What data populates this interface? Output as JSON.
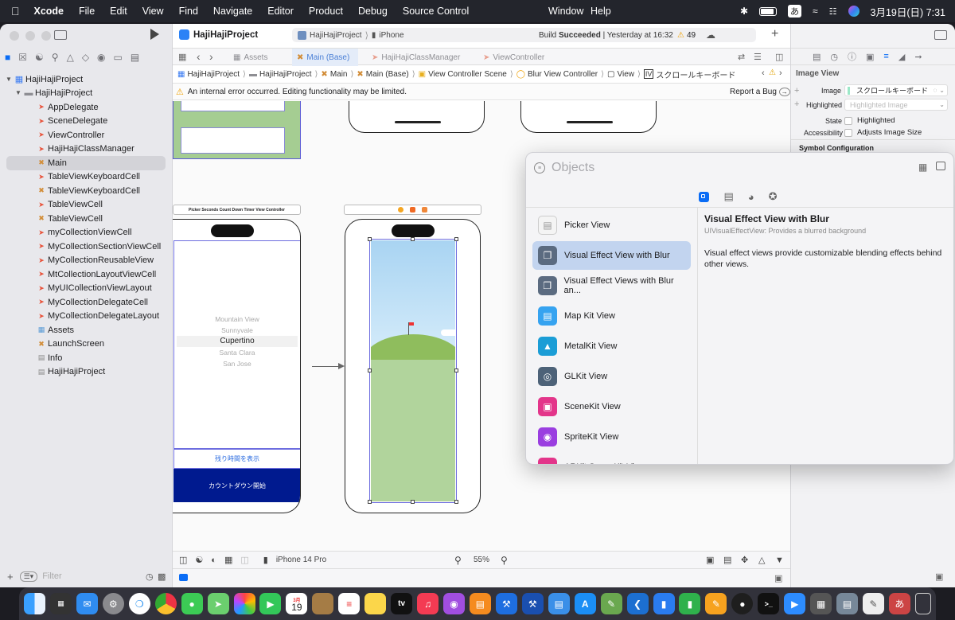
{
  "menubar": {
    "app": "Xcode",
    "items": [
      "File",
      "Edit",
      "View",
      "Find",
      "Navigate",
      "Editor",
      "Product",
      "Debug",
      "Source Control"
    ],
    "window": "Window",
    "help": "Help",
    "input_method": "あ",
    "clock": "3月19日(日)  7:31"
  },
  "toolbar": {
    "project": "HajiHajiProject",
    "scheme": "HajiHajiProject",
    "device": "iPhone",
    "status_prefix": "Build ",
    "status_bold": "Succeeded",
    "status_suffix": " | Yesterday at 16:32",
    "warnings": "49"
  },
  "tabs": [
    "Assets",
    "Main (Base)",
    "HajiHajiClassManager",
    "ViewController"
  ],
  "jumpbar": [
    "HajiHajiProject",
    "HajiHajiProject",
    "Main",
    "Main (Base)",
    "View Controller Scene",
    "Blur View Controller",
    "View",
    "スクロールキーボード"
  ],
  "warning_bar": {
    "message": "An internal error occurred. Editing functionality may be limited.",
    "report": "Report a Bug"
  },
  "navigator": {
    "root": "HajiHajiProject",
    "group": "HajiHajiProject",
    "files": [
      {
        "name": "AppDelegate",
        "kind": "swift"
      },
      {
        "name": "SceneDelegate",
        "kind": "swift"
      },
      {
        "name": "ViewController",
        "kind": "swift"
      },
      {
        "name": "HajiHajiClassManager",
        "kind": "swift"
      },
      {
        "name": "Main",
        "kind": "storyboard"
      },
      {
        "name": "TableViewKeyboardCell",
        "kind": "swift"
      },
      {
        "name": "TableViewKeyboardCell",
        "kind": "xib"
      },
      {
        "name": "TableViewCell",
        "kind": "swift"
      },
      {
        "name": "TableViewCell",
        "kind": "xib"
      },
      {
        "name": "myCollectionViewCell",
        "kind": "swift"
      },
      {
        "name": "MyCollectionSectionViewCell",
        "kind": "swift"
      },
      {
        "name": "MyCollectionReusableView",
        "kind": "swift"
      },
      {
        "name": "MtCollectionLayoutViewCell",
        "kind": "swift"
      },
      {
        "name": "MyUICollectionViewLayout",
        "kind": "swift"
      },
      {
        "name": "MyCollectionDelegateCell",
        "kind": "swift"
      },
      {
        "name": "MyCollectionDelegateLayout",
        "kind": "swift"
      },
      {
        "name": "Assets",
        "kind": "assets"
      },
      {
        "name": "LaunchScreen",
        "kind": "xib"
      },
      {
        "name": "Info",
        "kind": "plist"
      },
      {
        "name": "HajiHajiProject",
        "kind": "target"
      }
    ],
    "filter_placeholder": "Filter"
  },
  "canvas": {
    "picker_title": "Picker Seconds Count Down Timer View Controller",
    "picker_items": [
      "Mountain View",
      "Sunnyvale",
      "Cupertino",
      "Santa Clara",
      "San Jose"
    ],
    "remaining_button": "残り時間を表示",
    "countdown_button": "カウントダウン開始"
  },
  "bottom_bar": {
    "device": "iPhone 14 Pro",
    "zoom": "55%"
  },
  "inspector": {
    "section": "Image View",
    "image_label": "Image",
    "image_value": "スクロールキーボード",
    "highlighted_label": "Highlighted",
    "highlighted_placeholder": "Highlighted Image",
    "state_label": "State",
    "state_value": "Highlighted",
    "accessibility_label": "Accessibility",
    "accessibility_value": "Adjusts Image Size",
    "symbol_config": "Symbol Configuration"
  },
  "objects": {
    "search_placeholder": "Objects",
    "items": [
      "Picker View",
      "Visual Effect View with Blur",
      "Visual Effect Views with Blur an...",
      "Map Kit View",
      "MetalKit View",
      "GLKit View",
      "SceneKit View",
      "SpriteKit View",
      "ARKit SceneKit View"
    ],
    "detail_title": "Visual Effect View with Blur",
    "detail_subtitle": "UIVisualEffectView: Provides a blurred background",
    "detail_body": "Visual effect views provide customizable blending effects behind other views."
  },
  "dock": {
    "calendar_month": "3月",
    "calendar_day": "19",
    "tv_label": "tv"
  },
  "colors": {
    "accent": "#0a6cf5",
    "countdown_bg": "#001a8f",
    "grass": "#b1d49c",
    "sky": "#a9d4f2"
  }
}
